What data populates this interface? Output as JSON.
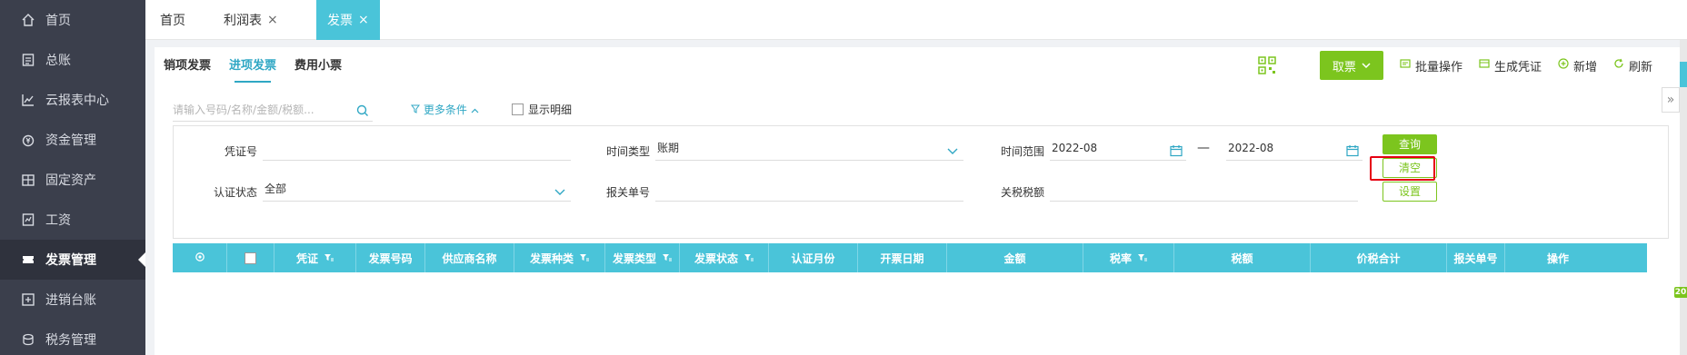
{
  "sidebar": {
    "items": [
      {
        "label": "首页",
        "icon": "home-icon"
      },
      {
        "label": "总账",
        "icon": "ledger-icon"
      },
      {
        "label": "云报表中心",
        "icon": "chart-icon"
      },
      {
        "label": "资金管理",
        "icon": "money-icon"
      },
      {
        "label": "固定资产",
        "icon": "asset-icon"
      },
      {
        "label": "工资",
        "icon": "salary-icon"
      },
      {
        "label": "发票管理",
        "icon": "invoice-icon"
      },
      {
        "label": "进销台账",
        "icon": "stock-ledger-icon"
      },
      {
        "label": "税务管理",
        "icon": "tax-icon"
      }
    ],
    "active_index": 6
  },
  "top_tabs": [
    {
      "label": "首页",
      "closable": false
    },
    {
      "label": "利润表",
      "closable": true
    },
    {
      "label": "发票",
      "closable": true,
      "active": true
    }
  ],
  "close_glyph": "×",
  "sub_tabs": [
    {
      "label": "销项发票"
    },
    {
      "label": "进项发票",
      "active": true
    },
    {
      "label": "费用小票"
    }
  ],
  "toolbar": {
    "fetch_label": "取票",
    "batch_label": "批量操作",
    "voucher_label": "生成凭证",
    "add_label": "新增",
    "refresh_label": "刷新"
  },
  "search": {
    "placeholder": "请输入号码/名称/金额/税额..."
  },
  "more_conditions_label": "更多条件",
  "show_detail_label": "显示明细",
  "filters": {
    "voucher_no_label": "凭证号",
    "voucher_no_value": "",
    "time_type_label": "时间类型",
    "time_type_value": "账期",
    "time_range_label": "时间范围",
    "time_range_start": "2022-08",
    "time_range_end": "2022-08",
    "range_separator": "—",
    "cert_status_label": "认证状态",
    "cert_status_value": "全部",
    "customs_no_label": "报关单号",
    "customs_no_value": "",
    "customs_tax_label": "关税税额",
    "customs_tax_value": "",
    "query_button": "查询",
    "clear_button": "清空",
    "settings_button": "设置"
  },
  "table": {
    "columns": [
      {
        "label": "",
        "kind": "settings"
      },
      {
        "label": "",
        "kind": "checkbox"
      },
      {
        "label": "凭证",
        "filter": true
      },
      {
        "label": "发票号码",
        "filter": false
      },
      {
        "label": "供应商名称",
        "filter": false
      },
      {
        "label": "发票种类",
        "filter": true
      },
      {
        "label": "发票类型",
        "filter": true
      },
      {
        "label": "发票状态",
        "filter": true
      },
      {
        "label": "认证月份",
        "filter": false
      },
      {
        "label": "开票日期",
        "filter": false
      },
      {
        "label": "金额",
        "filter": false
      },
      {
        "label": "税率",
        "filter": true
      },
      {
        "label": "税额",
        "filter": false
      },
      {
        "label": "价税合计",
        "filter": false
      },
      {
        "label": "报关单号",
        "filter": false
      },
      {
        "label": "操作",
        "filter": false
      }
    ]
  },
  "edge_badge": "20",
  "collapse_glyph": "»",
  "colors": {
    "sidebar_bg": "#3b3f4c",
    "accent_cyan": "#4ac4d9",
    "accent_green": "#7cc51e",
    "highlight_red": "#e60012"
  }
}
